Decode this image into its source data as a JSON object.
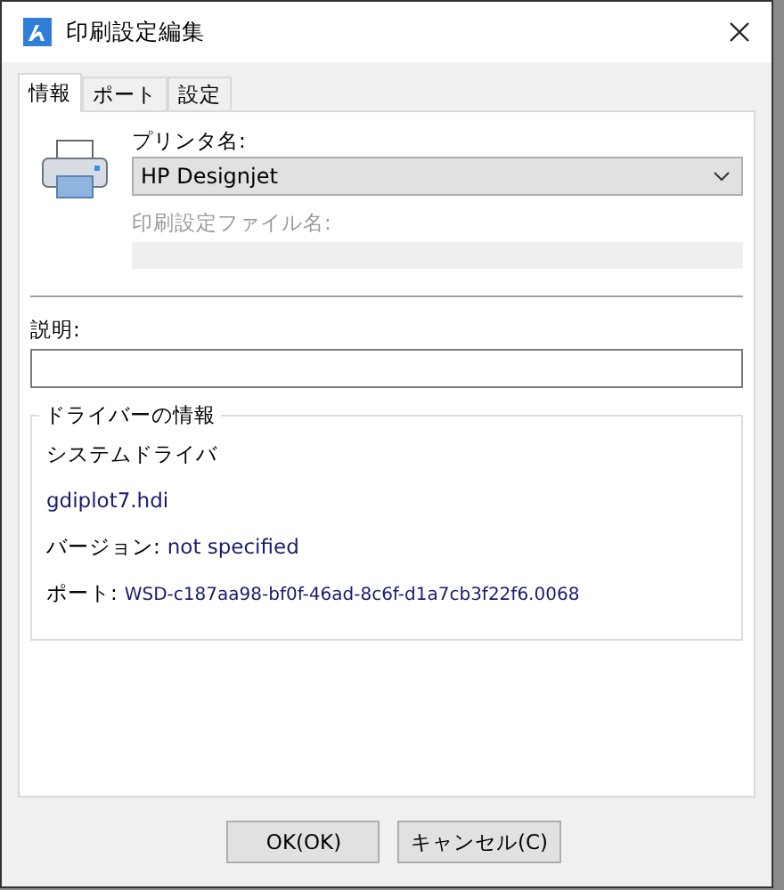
{
  "window": {
    "title": "印刷設定編集"
  },
  "tabs": [
    {
      "label": "情報",
      "selected": true
    },
    {
      "label": "ポート",
      "selected": false
    },
    {
      "label": "設定",
      "selected": false
    }
  ],
  "printer": {
    "label": "プリンタ名:",
    "value": "HP Designjet"
  },
  "settings_file": {
    "label": "印刷設定ファイル名:",
    "disabled": true
  },
  "description": {
    "label": "説明:"
  },
  "driver_info": {
    "title": "ドライバーの情報",
    "driver": "システムドライバ",
    "file": "gdiplot7.hdi",
    "version_label": "バージョン:",
    "version": "not specified",
    "port_label": "ポート:",
    "port": "WSD-c187aa98-bf0f-46ad-8c6f-d1a7cb3f22f6.0068"
  },
  "buttons": [
    "OK(OK)",
    "キャンセル(C)"
  ]
}
